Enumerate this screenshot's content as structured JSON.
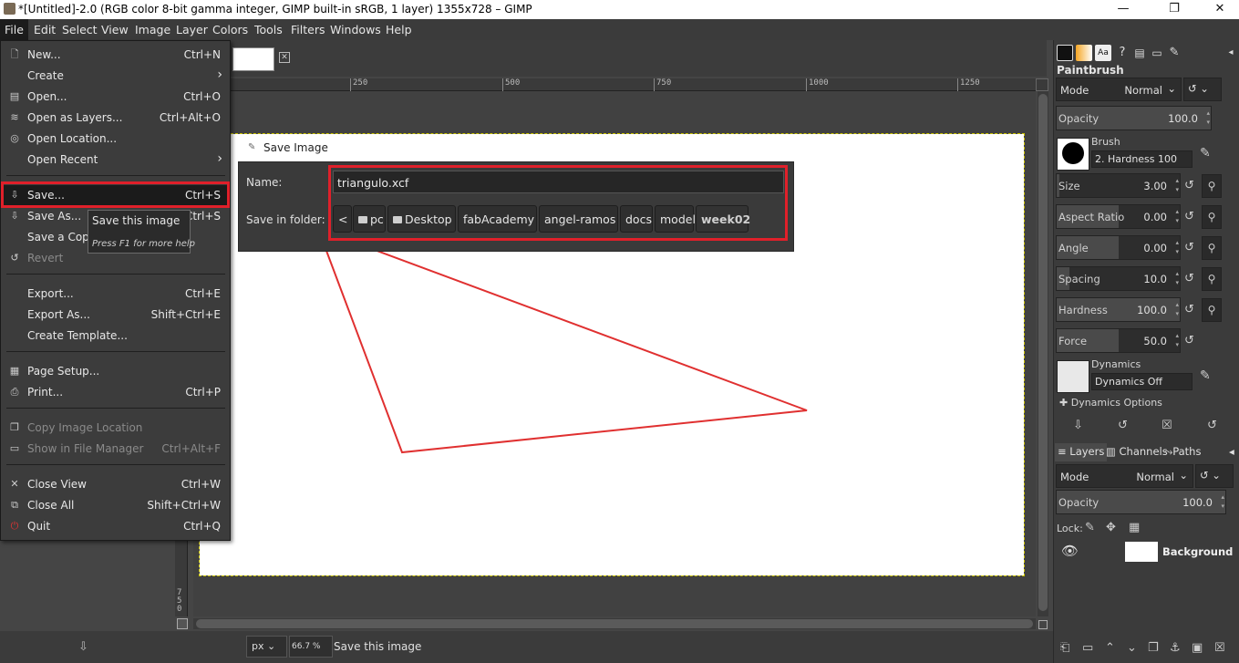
{
  "window": {
    "title": "*[Untitled]-2.0 (RGB color 8-bit gamma integer, GIMP built-in sRGB, 1 layer) 1355x728 – GIMP",
    "minimize": "—",
    "maximize": "❐",
    "close": "✕"
  },
  "menubar": [
    "File",
    "Edit",
    "Select",
    "View",
    "Image",
    "Layer",
    "Colors",
    "Tools",
    "Filters",
    "Windows",
    "Help"
  ],
  "file_menu": {
    "new": {
      "label": "New...",
      "accel": "Ctrl+N"
    },
    "create": {
      "label": "Create"
    },
    "open": {
      "label": "Open...",
      "accel": "Ctrl+O"
    },
    "open_as_layers": {
      "label": "Open as Layers...",
      "accel": "Ctrl+Alt+O"
    },
    "open_location": {
      "label": "Open Location..."
    },
    "open_recent": {
      "label": "Open Recent"
    },
    "save": {
      "label": "Save...",
      "accel": "Ctrl+S"
    },
    "save_as": {
      "label": "Save As...",
      "accel": "Shift+Ctrl+S"
    },
    "save_copy": {
      "label": "Save a Copy..."
    },
    "revert": {
      "label": "Revert"
    },
    "export": {
      "label": "Export...",
      "accel": "Ctrl+E"
    },
    "export_as": {
      "label": "Export As...",
      "accel": "Shift+Ctrl+E"
    },
    "create_template": {
      "label": "Create Template..."
    },
    "page_setup": {
      "label": "Page Setup..."
    },
    "print": {
      "label": "Print...",
      "accel": "Ctrl+P"
    },
    "copy_image_location": {
      "label": "Copy Image Location"
    },
    "show_in_file_manager": {
      "label": "Show in File Manager",
      "accel": "Ctrl+Alt+F"
    },
    "close_view": {
      "label": "Close View",
      "accel": "Ctrl+W"
    },
    "close_all": {
      "label": "Close All",
      "accel": "Shift+Ctrl+W"
    },
    "quit": {
      "label": "Quit",
      "accel": "Ctrl+Q"
    }
  },
  "tooltip": {
    "text": "Save this image",
    "help": "Press F1 for more help"
  },
  "ruler": {
    "h_ticks": [
      "250",
      "500",
      "750",
      "1000",
      "1250"
    ],
    "v_tick": "750"
  },
  "save_dialog": {
    "title": "Save Image",
    "name_label": "Name:",
    "name_value": "triangulo.xcf",
    "folder_label": "Save in folder:",
    "back": "<",
    "crumbs": [
      "pc",
      "Desktop",
      "fabAcademy",
      "angel-ramos",
      "docs",
      "model",
      "week02"
    ]
  },
  "statusbar": {
    "unit": "px",
    "zoom": "66.7 %",
    "message": "Save this image"
  },
  "tool_options": {
    "title": "Paintbrush",
    "mode_label": "Mode",
    "mode_value": "Normal",
    "opacity": {
      "label": "Opacity",
      "value": "100.0",
      "fill": 1.0
    },
    "brush_label": "Brush",
    "brush_value": "2. Hardness 100",
    "size": {
      "label": "Size",
      "value": "3.00",
      "fill": 0.02
    },
    "aspect_ratio": {
      "label": "Aspect Ratio",
      "value": "0.00",
      "fill": 0.5
    },
    "angle": {
      "label": "Angle",
      "value": "0.00",
      "fill": 0.5
    },
    "spacing": {
      "label": "Spacing",
      "value": "10.0",
      "fill": 0.1
    },
    "hardness": {
      "label": "Hardness",
      "value": "100.0",
      "fill": 1.0
    },
    "force": {
      "label": "Force",
      "value": "50.0",
      "fill": 0.5
    },
    "dynamics_label": "Dynamics",
    "dynamics_value": "Dynamics Off",
    "dynamics_options": "Dynamics Options"
  },
  "layers_dock": {
    "tabs": [
      "Layers",
      "Channels",
      "Paths"
    ],
    "mode_label": "Mode",
    "mode_value": "Normal",
    "opacity_label": "Opacity",
    "opacity_value": "100.0",
    "lock_label": "Lock:",
    "layer_name": "Background"
  },
  "colors": {
    "highlight_red": "#e0202a",
    "triangle_stroke": "#e03030"
  }
}
